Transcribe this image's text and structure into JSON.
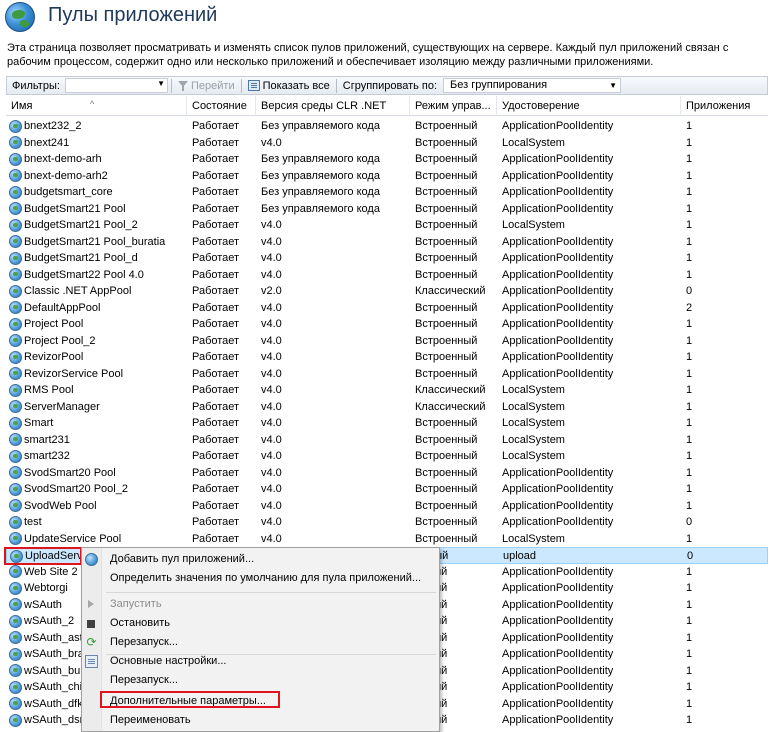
{
  "page": {
    "title": "Пулы приложений",
    "description": "Эта страница позволяет просматривать и изменять список пулов приложений, существующих на сервере. Каждый пул приложений связан с рабочим процессом, содержит одно или несколько приложений и обеспечивает изоляцию между различными приложениями."
  },
  "toolbar": {
    "filters_label": "Фильтры:",
    "go_label": "Перейти",
    "show_all_label": "Показать все",
    "group_by_label": "Сгруппировать по:",
    "group_by_value": "Без группирования"
  },
  "columns": [
    "Имя",
    "Состояние",
    "Версия среды CLR .NET",
    "Режим управ...",
    "Удостоверение",
    "Приложения"
  ],
  "rows": [
    {
      "name": "bnext232_2",
      "state": "Работает",
      "clr": "Без управляемого кода",
      "mode": "Встроенный",
      "identity": "ApplicationPoolIdentity",
      "apps": "1"
    },
    {
      "name": "bnext241",
      "state": "Работает",
      "clr": "v4.0",
      "mode": "Встроенный",
      "identity": "LocalSystem",
      "apps": "1"
    },
    {
      "name": "bnext-demo-arh",
      "state": "Работает",
      "clr": "Без управляемого кода",
      "mode": "Встроенный",
      "identity": "ApplicationPoolIdentity",
      "apps": "1"
    },
    {
      "name": "bnext-demo-arh2",
      "state": "Работает",
      "clr": "Без управляемого кода",
      "mode": "Встроенный",
      "identity": "ApplicationPoolIdentity",
      "apps": "1"
    },
    {
      "name": "budgetsmart_core",
      "state": "Работает",
      "clr": "Без управляемого кода",
      "mode": "Встроенный",
      "identity": "ApplicationPoolIdentity",
      "apps": "1"
    },
    {
      "name": "BudgetSmart21 Pool",
      "state": "Работает",
      "clr": "Без управляемого кода",
      "mode": "Встроенный",
      "identity": "ApplicationPoolIdentity",
      "apps": "1"
    },
    {
      "name": "BudgetSmart21 Pool_2",
      "state": "Работает",
      "clr": "v4.0",
      "mode": "Встроенный",
      "identity": "LocalSystem",
      "apps": "1"
    },
    {
      "name": "BudgetSmart21 Pool_buratia",
      "state": "Работает",
      "clr": "v4.0",
      "mode": "Встроенный",
      "identity": "ApplicationPoolIdentity",
      "apps": "1"
    },
    {
      "name": "BudgetSmart21 Pool_d",
      "state": "Работает",
      "clr": "v4.0",
      "mode": "Встроенный",
      "identity": "ApplicationPoolIdentity",
      "apps": "1"
    },
    {
      "name": "BudgetSmart22 Pool 4.0",
      "state": "Работает",
      "clr": "v4.0",
      "mode": "Встроенный",
      "identity": "ApplicationPoolIdentity",
      "apps": "1"
    },
    {
      "name": "Classic .NET AppPool",
      "state": "Работает",
      "clr": "v2.0",
      "mode": "Классический",
      "identity": "ApplicationPoolIdentity",
      "apps": "0"
    },
    {
      "name": "DefaultAppPool",
      "state": "Работает",
      "clr": "v4.0",
      "mode": "Встроенный",
      "identity": "ApplicationPoolIdentity",
      "apps": "2"
    },
    {
      "name": "Project Pool",
      "state": "Работает",
      "clr": "v4.0",
      "mode": "Встроенный",
      "identity": "ApplicationPoolIdentity",
      "apps": "1"
    },
    {
      "name": "Project Pool_2",
      "state": "Работает",
      "clr": "v4.0",
      "mode": "Встроенный",
      "identity": "ApplicationPoolIdentity",
      "apps": "1"
    },
    {
      "name": "RevizorPool",
      "state": "Работает",
      "clr": "v4.0",
      "mode": "Встроенный",
      "identity": "ApplicationPoolIdentity",
      "apps": "1"
    },
    {
      "name": "RevizorService Pool",
      "state": "Работает",
      "clr": "v4.0",
      "mode": "Встроенный",
      "identity": "ApplicationPoolIdentity",
      "apps": "1"
    },
    {
      "name": "RMS Pool",
      "state": "Работает",
      "clr": "v4.0",
      "mode": "Классический",
      "identity": "LocalSystem",
      "apps": "1"
    },
    {
      "name": "ServerManager",
      "state": "Работает",
      "clr": "v4.0",
      "mode": "Классический",
      "identity": "LocalSystem",
      "apps": "1"
    },
    {
      "name": "Smart",
      "state": "Работает",
      "clr": "v4.0",
      "mode": "Встроенный",
      "identity": "LocalSystem",
      "apps": "1"
    },
    {
      "name": "smart231",
      "state": "Работает",
      "clr": "v4.0",
      "mode": "Встроенный",
      "identity": "LocalSystem",
      "apps": "1"
    },
    {
      "name": "smart232",
      "state": "Работает",
      "clr": "v4.0",
      "mode": "Встроенный",
      "identity": "LocalSystem",
      "apps": "1"
    },
    {
      "name": "SvodSmart20 Pool",
      "state": "Работает",
      "clr": "v4.0",
      "mode": "Встроенный",
      "identity": "ApplicationPoolIdentity",
      "apps": "1"
    },
    {
      "name": "SvodSmart20 Pool_2",
      "state": "Работает",
      "clr": "v4.0",
      "mode": "Встроенный",
      "identity": "ApplicationPoolIdentity",
      "apps": "1"
    },
    {
      "name": "SvodWeb Pool",
      "state": "Работает",
      "clr": "v4.0",
      "mode": "Встроенный",
      "identity": "ApplicationPoolIdentity",
      "apps": "1"
    },
    {
      "name": "test",
      "state": "Работает",
      "clr": "v4.0",
      "mode": "Встроенный",
      "identity": "ApplicationPoolIdentity",
      "apps": "0"
    },
    {
      "name": "UpdateService Pool",
      "state": "Работает",
      "clr": "v4.0",
      "mode": "Встроенный",
      "identity": "LocalSystem",
      "apps": "1"
    },
    {
      "name": "UploadServ",
      "state": "",
      "clr": "",
      "mode": "енный",
      "identity": "upload",
      "apps": "0",
      "selected": true
    },
    {
      "name": "Web Site 2",
      "state": "",
      "clr": "",
      "mode": "енный",
      "identity": "ApplicationPoolIdentity",
      "apps": "1"
    },
    {
      "name": "Webtorgi",
      "state": "",
      "clr": "",
      "mode": "енный",
      "identity": "ApplicationPoolIdentity",
      "apps": "1"
    },
    {
      "name": "wSAuth",
      "state": "",
      "clr": "",
      "mode": "енный",
      "identity": "ApplicationPoolIdentity",
      "apps": "1"
    },
    {
      "name": "wSAuth_2",
      "state": "",
      "clr": "",
      "mode": "енный",
      "identity": "ApplicationPoolIdentity",
      "apps": "1"
    },
    {
      "name": "wSAuth_ast",
      "state": "",
      "clr": "",
      "mode": "енный",
      "identity": "ApplicationPoolIdentity",
      "apps": "1"
    },
    {
      "name": "wSAuth_bra",
      "state": "",
      "clr": "",
      "mode": "енный",
      "identity": "ApplicationPoolIdentity",
      "apps": "1"
    },
    {
      "name": "wSAuth_bu",
      "state": "",
      "clr": "",
      "mode": "енный",
      "identity": "ApplicationPoolIdentity",
      "apps": "1"
    },
    {
      "name": "wSAuth_chi",
      "state": "",
      "clr": "",
      "mode": "енный",
      "identity": "ApplicationPoolIdentity",
      "apps": "1"
    },
    {
      "name": "wSAuth_dfk",
      "state": "",
      "clr": "",
      "mode": "енный",
      "identity": "ApplicationPoolIdentity",
      "apps": "1"
    },
    {
      "name": "wSAuth_dsn",
      "state": "",
      "clr": "",
      "mode": "енный",
      "identity": "ApplicationPoolIdentity",
      "apps": "1"
    }
  ],
  "context_menu": {
    "add_pool": "Добавить пул приложений...",
    "set_defaults": "Определить значения по умолчанию для пула приложений...",
    "start": "Запустить",
    "stop": "Остановить",
    "recycle": "Перезапуск...",
    "basic_settings": "Основные настройки...",
    "recycle2": "Перезапуск...",
    "advanced_settings": "Дополнительные параметры...",
    "rename": "Переименовать"
  }
}
